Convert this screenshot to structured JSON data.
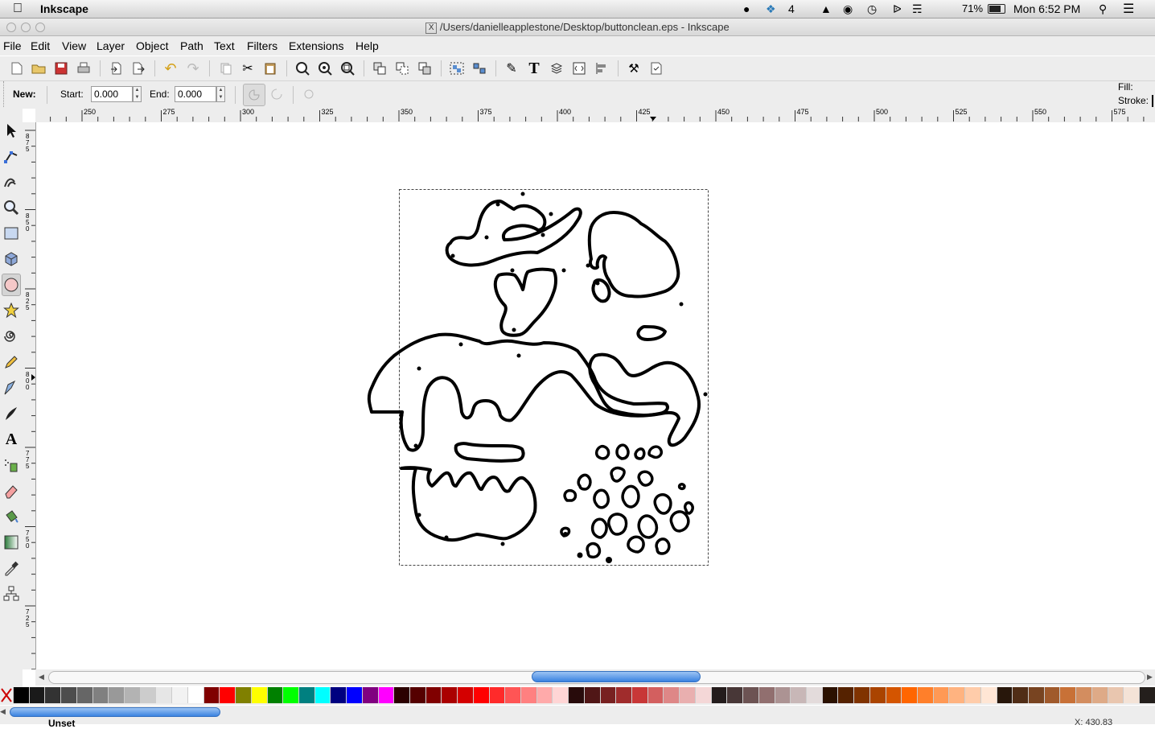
{
  "mac_menubar": {
    "app_name": "Inkscape",
    "battery": "71%",
    "clock": "Mon 6:52 PM",
    "adobe_badge": "4"
  },
  "window": {
    "title": "/Users/danielleapplestone/Desktop/buttonclean.eps - Inkscape"
  },
  "menu": {
    "items": [
      "File",
      "Edit",
      "View",
      "Layer",
      "Object",
      "Path",
      "Text",
      "Filters",
      "Extensions",
      "Help"
    ],
    "mnemonics": [
      "F",
      "E",
      "V",
      "L",
      "O",
      "P",
      "T",
      "F",
      "x",
      "H"
    ]
  },
  "controls": {
    "new_label": "New:",
    "start_label": "Start:",
    "start_value": "0.000",
    "end_label": "End:",
    "end_value": "0.000",
    "fill_label": "Fill:",
    "stroke_label": "Stroke:"
  },
  "ruler": {
    "h_labels": [
      "250",
      "275",
      "300",
      "325",
      "350",
      "375",
      "400",
      "425",
      "450",
      "475",
      "500",
      "525",
      "550",
      "575"
    ],
    "v_labels": [
      "875",
      "850",
      "825",
      "800",
      "775",
      "750",
      "725"
    ]
  },
  "status": {
    "left": "Unset",
    "coords": "X: 430.83"
  },
  "palette": {
    "colors": [
      "#000000",
      "#1a1a1a",
      "#333333",
      "#4d4d4d",
      "#666666",
      "#808080",
      "#999999",
      "#b3b3b3",
      "#cccccc",
      "#e6e6e6",
      "#f2f2f2",
      "#ffffff",
      "#800000",
      "#ff0000",
      "#808000",
      "#ffff00",
      "#008000",
      "#00ff00",
      "#008080",
      "#00ffff",
      "#000080",
      "#0000ff",
      "#800080",
      "#ff00ff",
      "#2b0000",
      "#550000",
      "#800000",
      "#aa0000",
      "#d40000",
      "#ff0000",
      "#ff2a2a",
      "#ff5555",
      "#ff8080",
      "#ffaaaa",
      "#ffd5d5",
      "#280b0b",
      "#501616",
      "#782121",
      "#a02c2c",
      "#c83737",
      "#d35f5f",
      "#de8787",
      "#e9afaf",
      "#f4d7d7",
      "#241c1c",
      "#483737",
      "#6c5353",
      "#916f6f",
      "#ac9393",
      "#c8b7b7",
      "#e3dbdb",
      "#2b1100",
      "#552200",
      "#803300",
      "#aa4400",
      "#d45500",
      "#ff6600",
      "#ff7f2a",
      "#ff9955",
      "#ffb380",
      "#ffccaa",
      "#ffe6d5",
      "#28170b",
      "#502d16",
      "#784421",
      "#a05a2c",
      "#c87137",
      "#d38d5f",
      "#deaa87",
      "#e9c6af",
      "#f4e3d7",
      "#241f1c"
    ]
  }
}
